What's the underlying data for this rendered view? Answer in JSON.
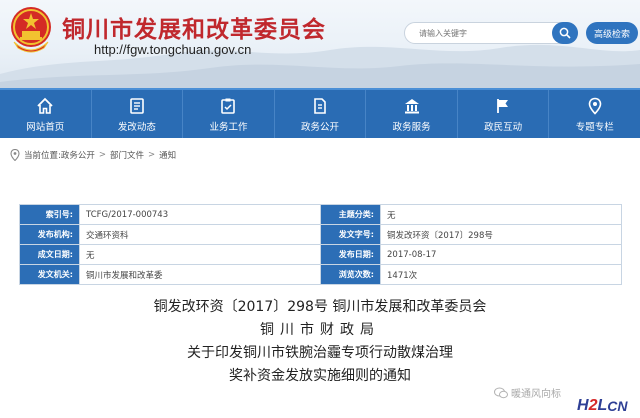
{
  "header": {
    "site_title": "铜川市发展和改革委员会",
    "site_url": "http://fgw.tongchuan.gov.cn",
    "search_placeholder": "请输入关键字",
    "advanced_search_label": "高级检索"
  },
  "nav": {
    "items": [
      {
        "label": "网站首页",
        "icon": "home-icon"
      },
      {
        "label": "发改动态",
        "icon": "news-icon"
      },
      {
        "label": "业务工作",
        "icon": "clipboard-icon"
      },
      {
        "label": "政务公开",
        "icon": "document-icon"
      },
      {
        "label": "政务服务",
        "icon": "building-icon"
      },
      {
        "label": "政民互动",
        "icon": "flag-icon"
      },
      {
        "label": "专题专栏",
        "icon": "pin-icon"
      }
    ]
  },
  "breadcrumb": {
    "prefix": "当前位置:",
    "items": [
      "政务公开",
      "部门文件",
      "通知"
    ],
    "separator": ">"
  },
  "info": {
    "index_label": "索引号:",
    "index_value": "TCFG/2017-000743",
    "category_label": "主题分类:",
    "category_value": "无",
    "org_label": "发布机构:",
    "org_value": "交通环资科",
    "docno_label": "发文字号:",
    "docno_value": "铜发改环资〔2017〕298号",
    "created_label": "成文日期:",
    "created_value": "无",
    "published_label": "发布日期:",
    "published_value": "2017-08-17",
    "issuer_label": "发文机关:",
    "issuer_value": "铜川市发展和改革委",
    "views_label": "浏览次数:",
    "views_value": "1471次"
  },
  "document": {
    "title_line1": "铜发改环资〔2017〕298号 铜川市发展和改革委员会",
    "title_line2": "铜川市财政局",
    "title_line3": "关于印发铜川市铁腕治霾专项行动散煤治理",
    "title_line4": "奖补资金发放实施细则的通知"
  },
  "watermark": {
    "wechat_text": "暖通风向标",
    "logo_h": "H",
    "logo_2": "2",
    "logo_l": "L",
    "logo_cn": "CN"
  },
  "colors": {
    "title_red": "#c0282d",
    "nav_blue": "#2a6cb4",
    "label_blue": "#2c6eb6"
  }
}
